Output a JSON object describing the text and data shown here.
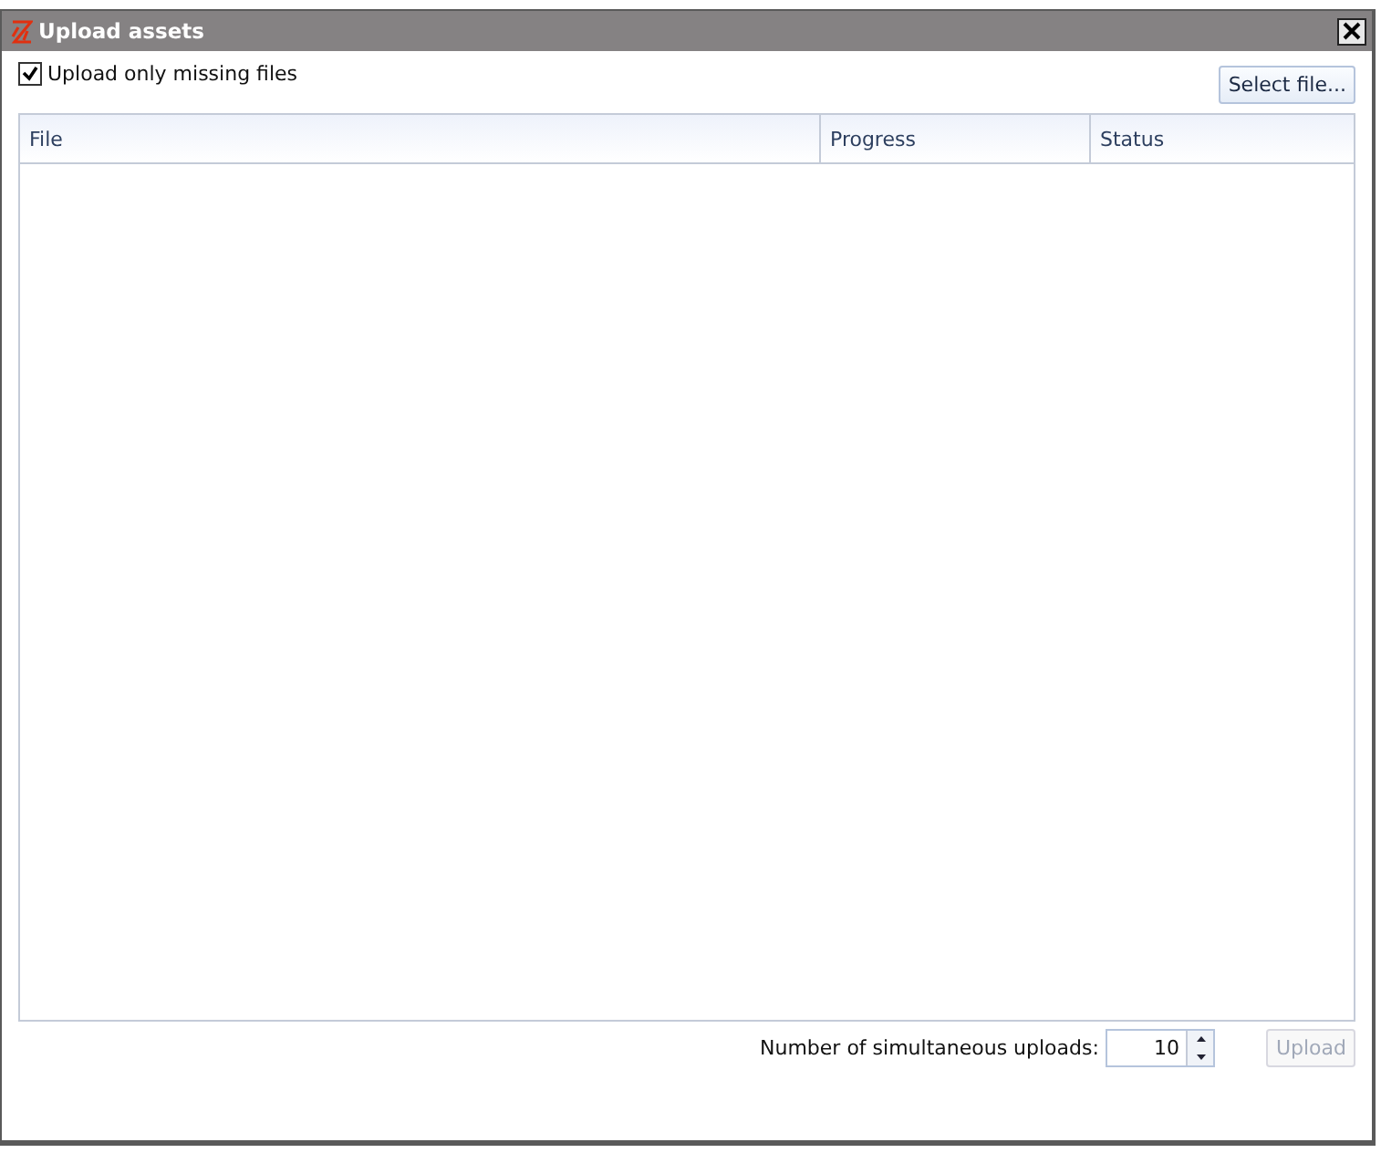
{
  "window": {
    "title": "Upload assets"
  },
  "upload_only_missing": {
    "label": "Upload only missing files",
    "checked": true
  },
  "select_file_button": {
    "label": "Select file...",
    "disabled": false
  },
  "table": {
    "columns": [
      "File",
      "Progress",
      "Status"
    ]
  },
  "simultaneous": {
    "label": "Number of simultaneous uploads:",
    "value": "10"
  },
  "upload_button": {
    "label": "Upload",
    "disabled": true
  }
}
